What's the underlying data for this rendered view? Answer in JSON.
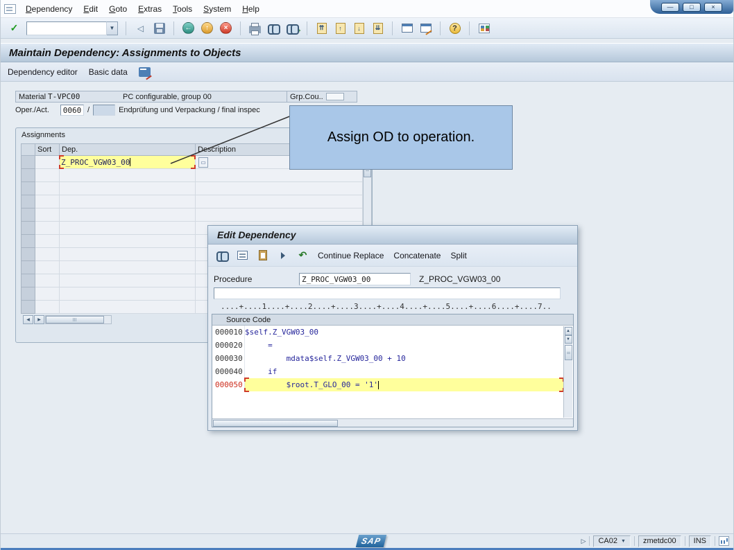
{
  "window": {
    "title": "Maintain Dependency: Assignments to Objects"
  },
  "menu": {
    "items": [
      "Dependency",
      "Edit",
      "Goto",
      "Extras",
      "Tools",
      "System",
      "Help"
    ]
  },
  "app_toolbar": {
    "buttons": [
      "Dependency editor",
      "Basic data"
    ]
  },
  "header": {
    "material_label": "Material",
    "material_value": "T-VPC00",
    "material_desc": "PC configurable, group 00",
    "grp_counter_label": "Grp.Cou..",
    "oper_label": "Oper./Act.",
    "oper_value": "0060",
    "oper_separator": "/",
    "oper_desc": "Endprüfung und Verpackung / final inspec"
  },
  "assignments": {
    "title": "Assignments",
    "columns": {
      "sort": "Sort",
      "dep": "Dep.",
      "description": "Description"
    },
    "row1_dep": "Z_PROC_VGW03_00"
  },
  "callout": {
    "text": "Assign OD to operation."
  },
  "dialog": {
    "title": "Edit Dependency",
    "buttons": {
      "continue_replace": "Continue Replace",
      "concatenate": "Concatenate",
      "split": "Split"
    },
    "procedure_label": "Procedure",
    "procedure_value": "Z_PROC_VGW03_00",
    "procedure_name": "Z_PROC_VGW03_00",
    "ruler": "....+....1....+....2....+....3....+....4....+....5....+....6....+....7..",
    "source_header": "Source Code",
    "lines": [
      {
        "num": "000010",
        "code": "$self.Z_VGW03_00"
      },
      {
        "num": "000020",
        "code": "     ="
      },
      {
        "num": "000030",
        "code": "         mdata$self.Z_VGW03_00 + 10"
      },
      {
        "num": "000040",
        "code": "     if"
      },
      {
        "num": "000050",
        "code": "         $root.T_GLO_00 = '1'"
      }
    ]
  },
  "status": {
    "transaction": "CA02",
    "user": "zmetdc00",
    "mode": "INS",
    "logo": "SAP"
  },
  "colors": {
    "highlight": "#FFFF9C",
    "selection_marker": "#CF3B2A",
    "callout_fill": "#A9C7E8"
  },
  "icons": {
    "enter": "✓",
    "dropdown": "▼",
    "back_small": "◁",
    "back": "←",
    "exit": "↑",
    "cancel": "×",
    "first_page": "⇈",
    "prev_page": "↑",
    "next_page": "↓",
    "last_page": "⇊",
    "help": "?",
    "undo": "↶",
    "msg_expand": "▷",
    "up": "▲",
    "down": "▼",
    "left": "◀",
    "right": "▶",
    "min": "—",
    "restore": "□",
    "close": "×"
  }
}
